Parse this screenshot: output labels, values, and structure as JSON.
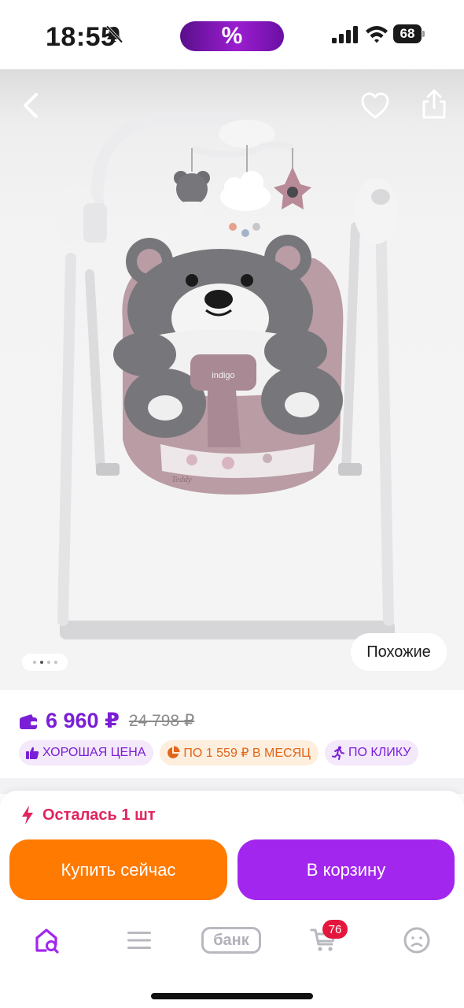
{
  "status_bar": {
    "time": "18:55",
    "promo_symbol": "%",
    "battery": "68"
  },
  "gallery": {
    "seat_brand": "indigo",
    "seat_model": "Teddy",
    "similar_label": "Похожие",
    "dots_count": 4,
    "active_dot": 2
  },
  "price": {
    "current": "6 960 ₽",
    "old": "24 798 ₽",
    "badges": [
      {
        "label": "ХОРОШАЯ ЦЕНА",
        "icon": "thumbs-up-icon"
      },
      {
        "label": "ПО 1 559 ₽ В МЕСЯЦ",
        "icon": "pie-chart-icon"
      },
      {
        "label": "ПО КЛИКУ",
        "icon": "running-person-icon"
      }
    ]
  },
  "stock": {
    "text": "Осталась 1 шт"
  },
  "actions": {
    "buy_now": "Купить сейчас",
    "add_to_cart": "В корзину"
  },
  "nav": {
    "bank_label": "банк",
    "cart_count": "76"
  },
  "colors": {
    "accent_purple": "#a326ee",
    "accent_orange": "#ff7a00",
    "stock_red": "#e0245e",
    "badge_red": "#e3173e"
  }
}
